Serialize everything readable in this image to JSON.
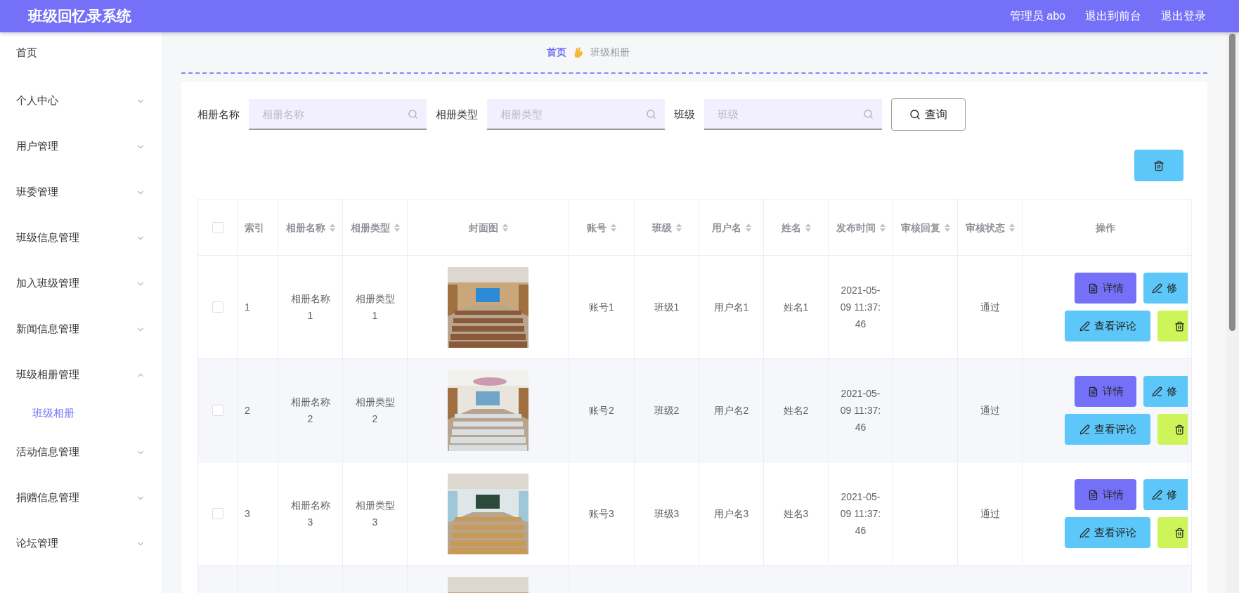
{
  "header": {
    "title": "班级回忆录系统",
    "links": [
      "管理员 abo",
      "退出到前台",
      "退出登录"
    ]
  },
  "sidebar": {
    "items": [
      {
        "label": "首页",
        "kind": "link"
      },
      {
        "label": "个人中心",
        "kind": "menu",
        "expanded": false
      },
      {
        "label": "用户管理",
        "kind": "menu",
        "expanded": false
      },
      {
        "label": "班委管理",
        "kind": "menu",
        "expanded": false
      },
      {
        "label": "班级信息管理",
        "kind": "menu",
        "expanded": false
      },
      {
        "label": "加入班级管理",
        "kind": "menu",
        "expanded": false
      },
      {
        "label": "新闻信息管理",
        "kind": "menu",
        "expanded": false
      },
      {
        "label": "班级相册管理",
        "kind": "menu",
        "expanded": true,
        "children": [
          {
            "label": "班级相册",
            "selected": true
          }
        ]
      },
      {
        "label": "活动信息管理",
        "kind": "menu",
        "expanded": false
      },
      {
        "label": "捐赠信息管理",
        "kind": "menu",
        "expanded": false
      },
      {
        "label": "论坛管理",
        "kind": "menu",
        "expanded": false
      }
    ]
  },
  "breadcrumb": [
    {
      "label": "首页",
      "current": false
    },
    {
      "label": "班级相册",
      "current": true
    }
  ],
  "search": {
    "fields": [
      {
        "label": "相册名称",
        "placeholder": "相册名称"
      },
      {
        "label": "相册类型",
        "placeholder": "相册类型"
      },
      {
        "label": "班级",
        "placeholder": "班级"
      }
    ],
    "button": "查询"
  },
  "table": {
    "select_all": {
      "checked": false
    },
    "columns": [
      {
        "label": "索引",
        "sortable": false
      },
      {
        "label": "相册名称",
        "sortable": true
      },
      {
        "label": "相册类型",
        "sortable": true
      },
      {
        "label": "封面图",
        "sortable": true
      },
      {
        "label": "账号",
        "sortable": true
      },
      {
        "label": "班级",
        "sortable": true
      },
      {
        "label": "用户名",
        "sortable": true
      },
      {
        "label": "姓名",
        "sortable": true
      },
      {
        "label": "发布时间",
        "sortable": true
      },
      {
        "label": "审核回复",
        "sortable": true
      },
      {
        "label": "审核状态",
        "sortable": true
      },
      {
        "label": "操作",
        "sortable": false
      }
    ],
    "rows": [
      {
        "checked": false,
        "cells": [
          "1",
          "相册名称1",
          "相册类型1",
          {
            "kind": "picture"
          },
          "账号1",
          "班级1",
          "用户名1",
          "姓名1",
          "2021-05-09 11:37:46",
          "",
          "通过"
        ],
        "actions": [
          [
            {
              "kind": "detail",
              "label": "详情"
            },
            {
              "kind": "edit",
              "label": "修"
            }
          ],
          [
            {
              "kind": "comments",
              "label": "查看评论"
            },
            {
              "kind": "delete"
            }
          ]
        ]
      },
      {
        "checked": false,
        "cells": [
          "2",
          "相册名称2",
          "相册类型2",
          {
            "kind": "picture"
          },
          "账号2",
          "班级2",
          "用户名2",
          "姓名2",
          "2021-05-09 11:37:46",
          "",
          "通过"
        ],
        "actions": [
          [
            {
              "kind": "detail",
              "label": "详情"
            },
            {
              "kind": "edit",
              "label": "修"
            }
          ],
          [
            {
              "kind": "comments",
              "label": "查看评论"
            },
            {
              "kind": "delete"
            }
          ]
        ]
      },
      {
        "checked": false,
        "cells": [
          "3",
          "相册名称3",
          "相册类型3",
          {
            "kind": "picture"
          },
          "账号3",
          "班级3",
          "用户名3",
          "姓名3",
          "2021-05-09 11:37:46",
          "",
          "通过"
        ],
        "actions": [
          [
            {
              "kind": "detail",
              "label": "详情"
            },
            {
              "kind": "edit",
              "label": "修"
            }
          ],
          [
            {
              "kind": "comments",
              "label": "查看评论"
            },
            {
              "kind": "delete"
            }
          ]
        ]
      }
    ],
    "partial_row": {
      "kind": "picture"
    }
  }
}
